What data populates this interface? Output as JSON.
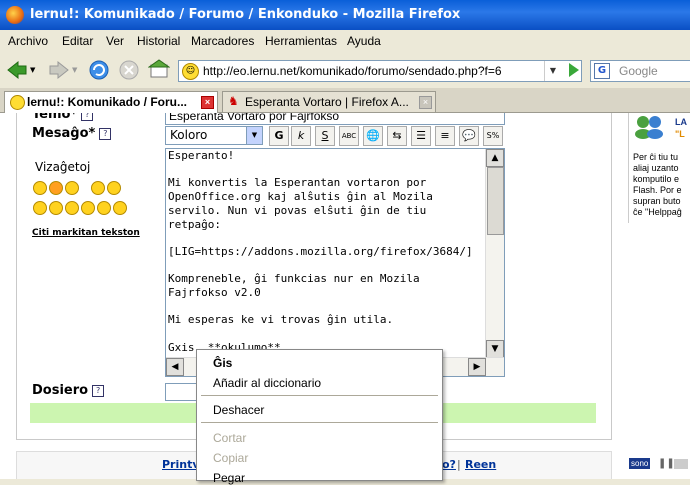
{
  "window": {
    "title": "lernu!: Komunikado / Forumo / Enkonduko - Mozilla Firefox"
  },
  "menubar": [
    "Archivo",
    "Editar",
    "Ver",
    "Historial",
    "Marcadores",
    "Herramientas",
    "Ayuda"
  ],
  "navbar": {
    "url": "http://eo.lernu.net/komunikado/forumo/sendado.php?f=6",
    "search_placeholder": "Google"
  },
  "tabs": [
    {
      "label": "lernu!: Komunikado / Foru...",
      "active": true
    },
    {
      "label": "Esperanta Vortaro | Firefox A...",
      "active": false
    }
  ],
  "form": {
    "temo_label": "Temo*",
    "temo_value": "Esperanta Vortaro por Fajrfokso",
    "mesago_label": "Mesaĝo*",
    "color_select": "Koloro",
    "tool_buttons": [
      "G",
      "k",
      "S",
      "ABC",
      "🌐",
      "⇆",
      "☰",
      "≡",
      "💬",
      "S%"
    ],
    "vizagetoj_label": "Vizaĝetoj",
    "citi_link": "Citi markitan tekston",
    "message_lines": [
      "Esperanto!",
      "",
      "Mi konvertis la Esperantan vortaron por",
      "OpenOffice.org kaj alŝutis ĝin al Mozila",
      "servilo. Nun vi povas elŝuti ĝin de tiu",
      "retpaĝo:",
      "",
      "[LIG=https://addons.mozilla.org/firefox/3684/]",
      "",
      "Kompreneble, ĝi funkcias nur en Mozila",
      "Fajrfokso v2.0",
      "",
      "Mi esperas ke vi trovas ĝin utila.",
      "",
      "Gxis, **okulumo**"
    ],
    "dosiero_label": "Dosiero"
  },
  "sidebar": {
    "badge": "LA",
    "badge2": "\"L",
    "text_lines": [
      "Per ĉi tiu tu",
      "aliaj uzanto",
      "komputilo e",
      "Flash. Por e",
      "supran buto",
      "ĉe \"Helppaĝ"
    ]
  },
  "footer": {
    "left_link": "Printv",
    "right_text": "o?",
    "right_link": "Reen"
  },
  "context_menu": {
    "items": [
      {
        "label": "Ĝis",
        "bold": true,
        "enabled": true
      },
      {
        "label": "Añadir al diccionario",
        "enabled": true
      },
      {
        "label": "Deshacer",
        "enabled": true
      },
      {
        "label": "Cortar",
        "enabled": false
      },
      {
        "label": "Copiar",
        "enabled": false
      },
      {
        "label": "Pegar",
        "enabled": true
      }
    ]
  },
  "sono_label": "sono"
}
